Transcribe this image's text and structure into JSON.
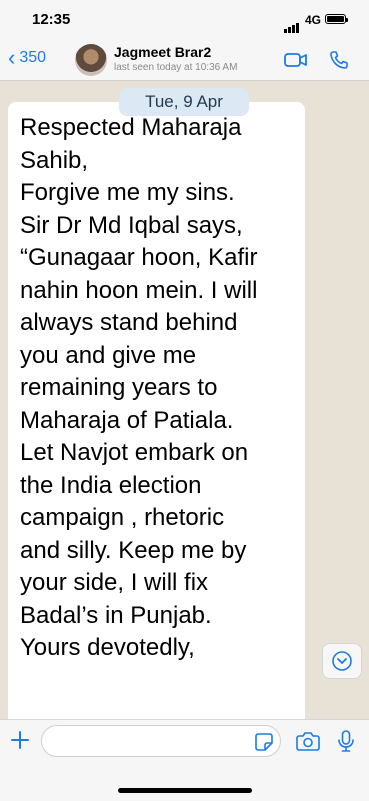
{
  "status_bar": {
    "time": "12:35",
    "network": "4G",
    "battery_level": 1.0
  },
  "header": {
    "back_count": "350",
    "contact_name": "Jagmeet Brar2",
    "last_seen": "last seen today at 10:36 AM"
  },
  "chat": {
    "date_label": "Tue, 9 Apr",
    "message": "Respected Maharaja\nSahib,\nForgive me my sins.\nSir Dr Md Iqbal says,\n“Gunagaar hoon, Kafir\nnahin hoon mein. I will\nalways stand behind\nyou and give me\nremaining years to\nMaharaja of Patiala.\nLet Navjot embark on\nthe India election\ncampaign , rhetoric\nand silly. Keep me by\nyour side, I will fix\nBadal’s in Punjab.\nYours devotedly,"
  },
  "input": {
    "placeholder": "",
    "value": ""
  },
  "icons": {
    "back": "chevron-left-icon",
    "video": "video-camera-icon",
    "phone": "phone-icon",
    "scroll_down": "chevron-down-icon",
    "add": "plus-icon",
    "sticker": "sticker-icon",
    "camera": "camera-icon",
    "mic": "microphone-icon"
  },
  "colors": {
    "accent": "#1b7ce6",
    "chat_background": "#e8e2d6",
    "date_pill": "#dce8f3"
  }
}
